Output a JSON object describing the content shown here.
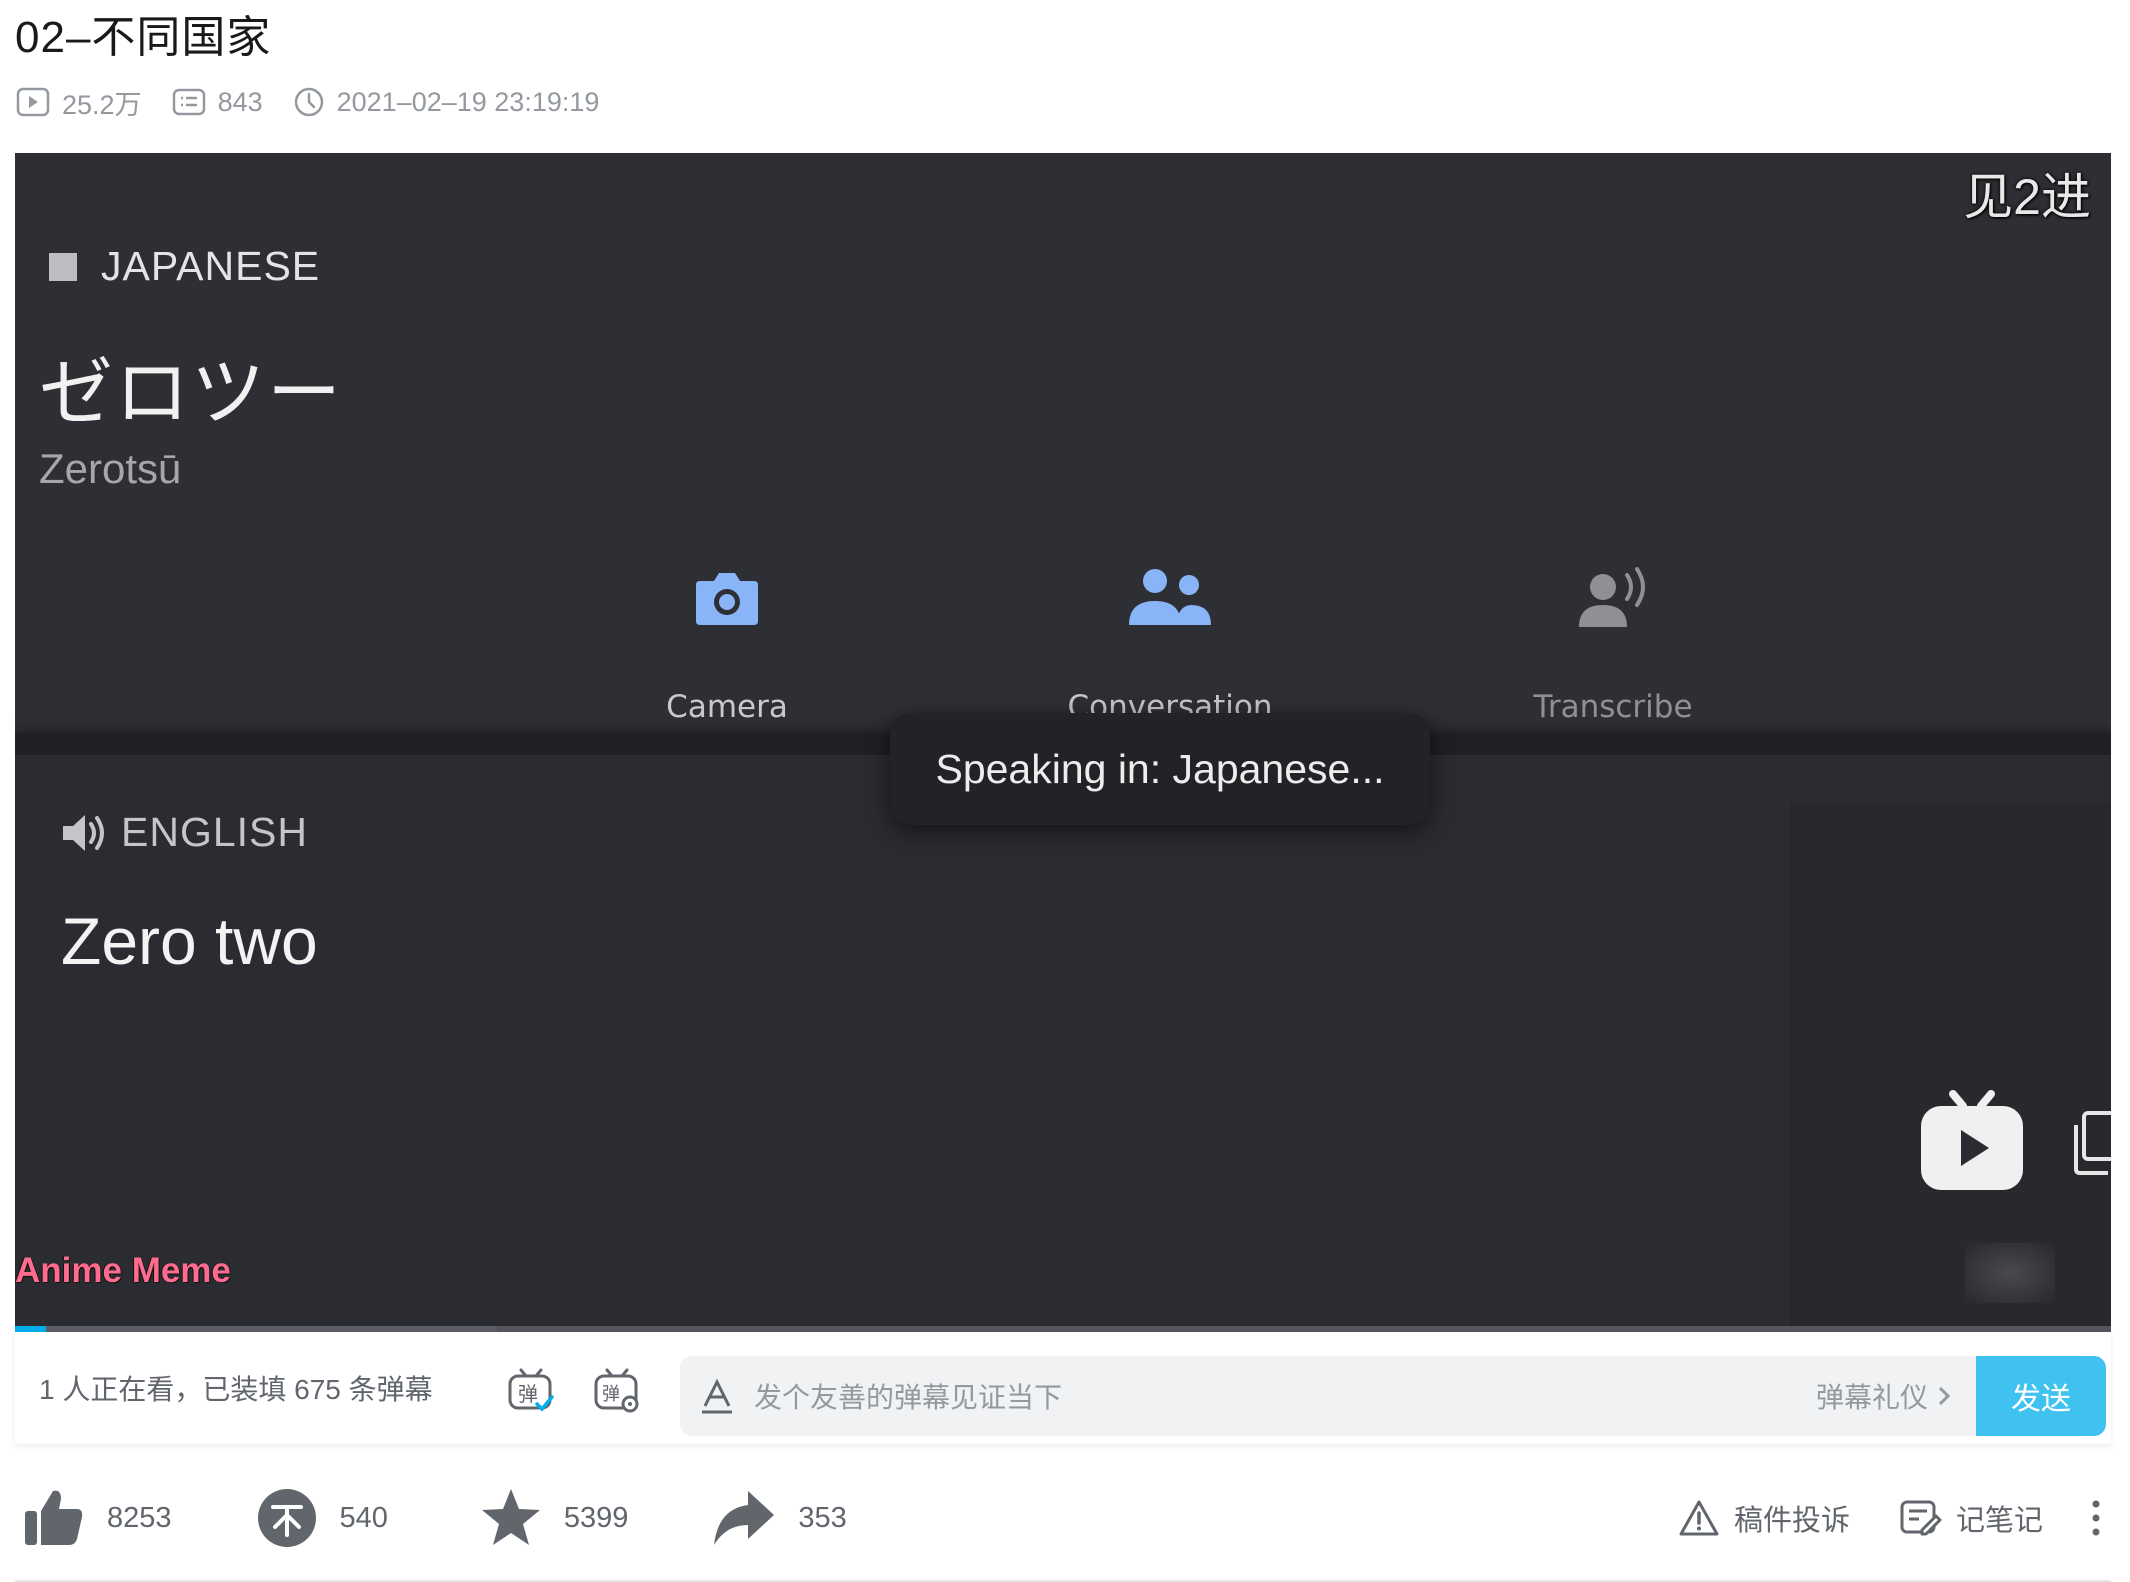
{
  "video": {
    "title": "02–不同国家",
    "views": "25.2万",
    "danmaku_count": "843",
    "published": "2021–02–19 23:19:19"
  },
  "player": {
    "watermark_top_right": "见2进",
    "source_language": "JAPANESE",
    "source_text": "ゼロツー",
    "romanization": "Zerotsū",
    "tools": [
      {
        "label": "Camera",
        "icon": "camera-icon"
      },
      {
        "label": "Conversation",
        "icon": "conversation-icon"
      },
      {
        "label": "Transcribe",
        "icon": "transcribe-icon"
      }
    ],
    "toast": "Speaking in: Japanese...",
    "target_language": "ENGLISH",
    "target_text": "Zero two",
    "channel_tag": "Anime Meme",
    "progress": 0.015,
    "buffered": 0.23
  },
  "danmaku_bar": {
    "status": "1 人正在看，已装填 675 条弹幕",
    "placeholder": "发个友善的弹幕见证当下",
    "etiquette": "弹幕礼仪",
    "send": "发送"
  },
  "toolbar": {
    "like": "8253",
    "coin": "540",
    "favorite": "5399",
    "share": "353",
    "report": "稿件投诉",
    "note": "记笔记"
  },
  "colors": {
    "accent": "#00aeec",
    "player_bg": "#2d2e33",
    "tool_icon": "#8ab4f8",
    "channel_tag": "#ff6b8e"
  }
}
